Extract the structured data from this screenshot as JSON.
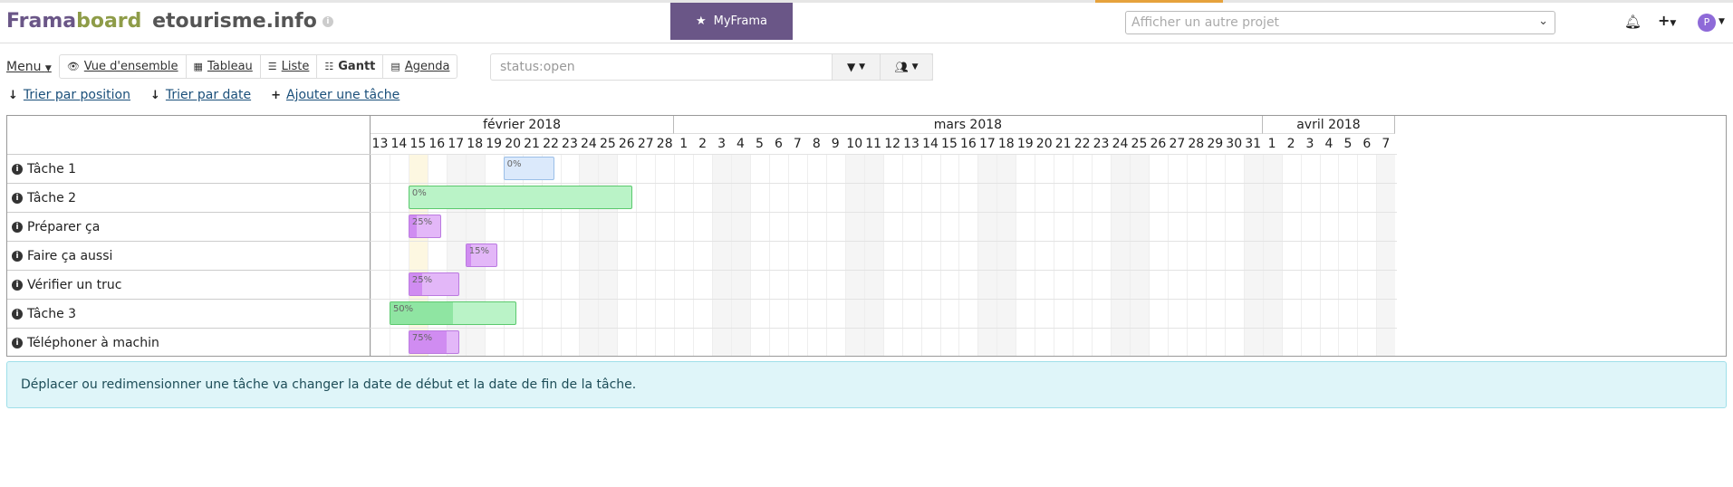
{
  "header": {
    "logo_part1": "Frama",
    "logo_part2": "board",
    "project_name": "etourisme.info",
    "myframa_label": "MyFrama",
    "project_select_placeholder": "Afficher un autre projet",
    "avatar_letter": "P"
  },
  "toolbar": {
    "menu_label": "Menu",
    "views": [
      {
        "label": "Vue d'ensemble",
        "icon": "eye-icon"
      },
      {
        "label": "Tableau",
        "icon": "grid-icon"
      },
      {
        "label": "Liste",
        "icon": "list-icon"
      },
      {
        "label": "Gantt",
        "icon": "sliders-icon",
        "active": true
      },
      {
        "label": "Agenda",
        "icon": "calendar-icon"
      }
    ],
    "search_value": "status:open"
  },
  "actions": {
    "sort_position": "Trier par position",
    "sort_date": "Trier par date",
    "add_task": "Ajouter une tâche"
  },
  "gantt": {
    "months": [
      {
        "label": "février 2018",
        "days": 16
      },
      {
        "label": "mars 2018",
        "days": 31
      },
      {
        "label": "avril 2018",
        "days": 7
      }
    ],
    "days": [
      "13",
      "14",
      "15",
      "16",
      "17",
      "18",
      "19",
      "20",
      "21",
      "22",
      "23",
      "24",
      "25",
      "26",
      "27",
      "28",
      "1",
      "2",
      "3",
      "4",
      "5",
      "6",
      "7",
      "8",
      "9",
      "10",
      "11",
      "12",
      "13",
      "14",
      "15",
      "16",
      "17",
      "18",
      "19",
      "20",
      "21",
      "22",
      "23",
      "24",
      "25",
      "26",
      "27",
      "28",
      "29",
      "30",
      "31",
      "1",
      "2",
      "3",
      "4",
      "5",
      "6",
      "7"
    ],
    "weekend_indices": [
      4,
      5,
      11,
      12,
      18,
      19,
      25,
      26,
      32,
      33,
      39,
      40,
      46,
      47,
      53
    ],
    "today_index": 2,
    "tasks": [
      {
        "name": "Tâche 1",
        "start": 7,
        "duration": 2.7,
        "progress": 0,
        "progress_label": "0%",
        "color": "blue"
      },
      {
        "name": "Tâche 2",
        "start": 2,
        "duration": 11.8,
        "progress": 0,
        "progress_label": "0%",
        "color": "green"
      },
      {
        "name": "Préparer ça",
        "start": 2,
        "duration": 1.7,
        "progress": 25,
        "progress_label": "25%",
        "color": "purple"
      },
      {
        "name": "Faire ça aussi",
        "start": 5,
        "duration": 1.7,
        "progress": 15,
        "progress_label": "15%",
        "color": "purple"
      },
      {
        "name": "Vérifier un truc",
        "start": 2,
        "duration": 2.7,
        "progress": 25,
        "progress_label": "25%",
        "color": "purple"
      },
      {
        "name": "Tâche 3",
        "start": 1,
        "duration": 6.7,
        "progress": 50,
        "progress_label": "50%",
        "color": "green"
      },
      {
        "name": "Téléphoner à machin",
        "start": 2,
        "duration": 2.7,
        "progress": 75,
        "progress_label": "75%",
        "color": "purple"
      }
    ]
  },
  "alert_text": "Déplacer ou redimensionner une tâche va changer la date de début et la date de fin de la tâche."
}
